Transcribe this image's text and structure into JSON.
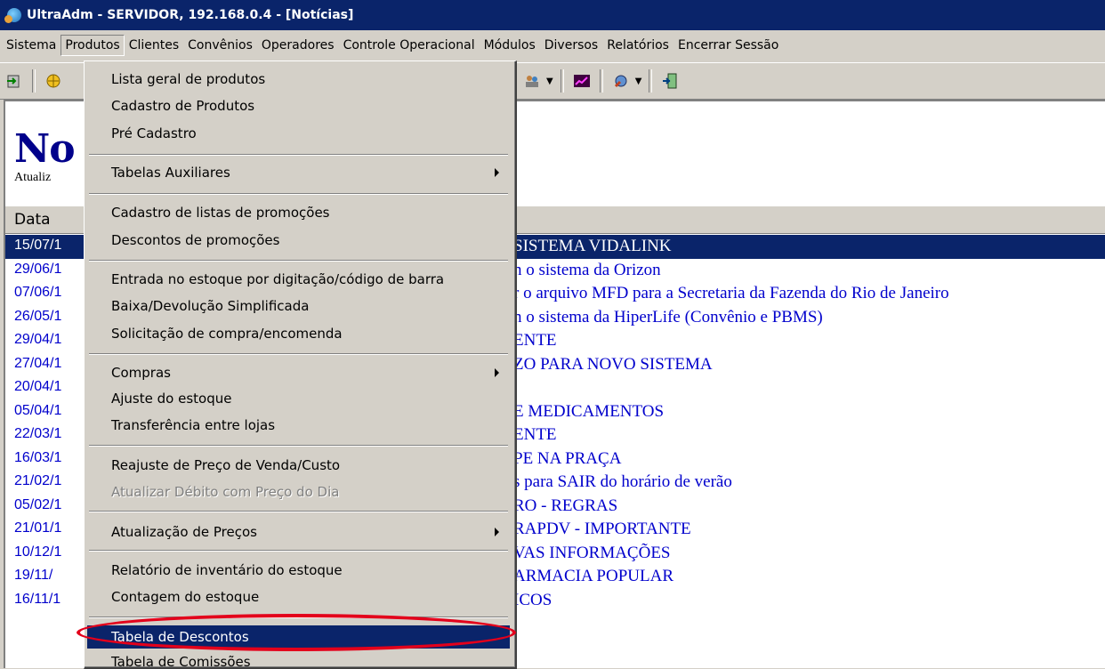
{
  "window": {
    "title": "UltraAdm - SERVIDOR, 192.168.0.4 - [Notícias]"
  },
  "menubar": {
    "items": [
      "Sistema",
      "Produtos",
      "Clientes",
      "Convênios",
      "Operadores",
      "Controle Operacional",
      "Módulos",
      "Diversos",
      "Relatórios",
      "Encerrar Sessão"
    ]
  },
  "page": {
    "title": "No",
    "subtitle": "Atualiz",
    "column_header": "Data"
  },
  "news": [
    {
      "date": "15/07/1",
      "text": "SISTEMA VIDALINK",
      "selected": true
    },
    {
      "date": "29/06/1",
      "text": "n o sistema da Orizon"
    },
    {
      "date": "07/06/1",
      "text": "r o arquivo MFD para a Secretaria da Fazenda do Rio de Janeiro"
    },
    {
      "date": "26/05/1",
      "text": "n o sistema da HiperLife (Convênio e PBMS)"
    },
    {
      "date": "29/04/1",
      "text": "ENTE"
    },
    {
      "date": "27/04/1",
      "text": "ZO PARA NOVO SISTEMA"
    },
    {
      "date": "20/04/1",
      "text": ""
    },
    {
      "date": "05/04/1",
      "text": "E MEDICAMENTOS"
    },
    {
      "date": "22/03/1",
      "text": "ENTE"
    },
    {
      "date": "16/03/1",
      "text": "PE NA PRAÇA"
    },
    {
      "date": "21/02/1",
      "text": "s para SAIR do horário de verão"
    },
    {
      "date": "05/02/1",
      "text": "RO - REGRAS"
    },
    {
      "date": "21/01/1",
      "text": "RAPDV - IMPORTANTE"
    },
    {
      "date": "10/12/1",
      "text": "VAS INFORMAÇÕES"
    },
    {
      "date": "19/11/",
      "text": "ARMACIA POPULAR"
    },
    {
      "date": "16/11/1",
      "text": "ICOS"
    }
  ],
  "dropdown": {
    "items": [
      {
        "label": "Lista geral de produtos"
      },
      {
        "label": "Cadastro de Produtos"
      },
      {
        "label": "Pré Cadastro"
      },
      {
        "label": "Tabelas Auxiliares",
        "submenu": true
      },
      {
        "label": "Cadastro de listas de promoções"
      },
      {
        "label": "Descontos de promoções"
      },
      {
        "label": "Entrada no estoque por digitação/código de barra"
      },
      {
        "label": "Baixa/Devolução Simplificada"
      },
      {
        "label": "Solicitação de compra/encomenda"
      },
      {
        "label": "Compras",
        "submenu": true
      },
      {
        "label": "Ajuste do estoque"
      },
      {
        "label": "Transferência entre lojas"
      },
      {
        "label": "Reajuste de Preço de Venda/Custo"
      },
      {
        "label": "Atualizar Débito com Preço do Dia",
        "disabled": true
      },
      {
        "label": "Atualização de Preços",
        "submenu": true
      },
      {
        "label": "Relatório de inventário do estoque"
      },
      {
        "label": "Contagem do estoque"
      },
      {
        "label": "Tabela de Descontos",
        "highlighted": true
      },
      {
        "label": "Tabela de Comissões"
      }
    ]
  },
  "colors": {
    "title_bar": "#0a246a",
    "link_text": "#0000cc",
    "highlight_circle": "#e3001b",
    "chrome": "#d4d0c8"
  }
}
